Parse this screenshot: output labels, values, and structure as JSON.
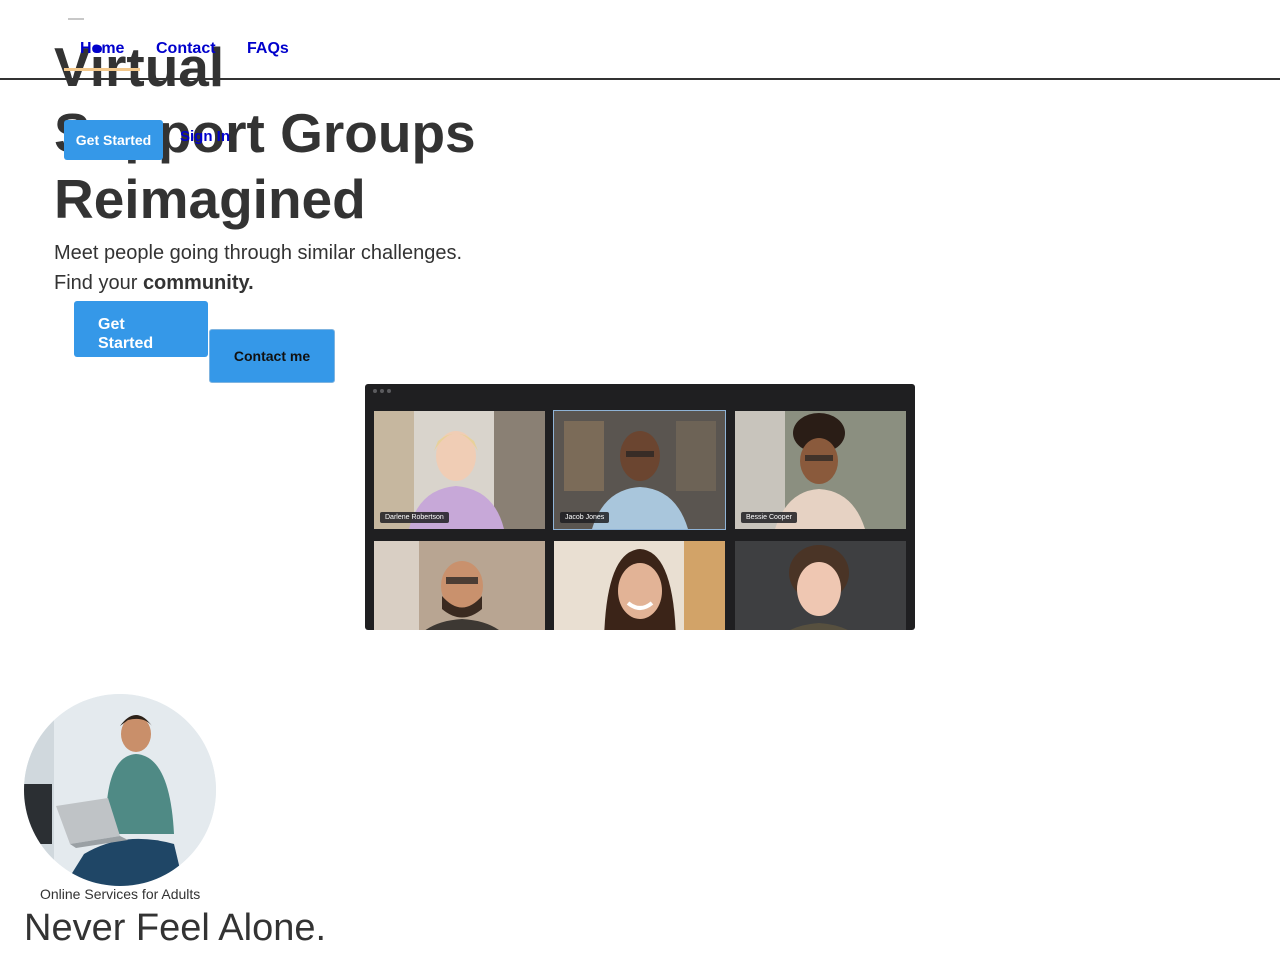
{
  "nav": {
    "links": [
      "Home",
      "Contact",
      "FAQs"
    ],
    "get_started": "Get Started",
    "sign_in": "Sign In",
    "active_color": "#0000cc",
    "underline_color": "#f3c88b"
  },
  "hero": {
    "title_lines": [
      "Virtual",
      "Support Groups",
      "Reimagined"
    ],
    "subtitle_line1": "Meet people going through similar challenges.",
    "subtitle_line2_prefix": "Find your ",
    "subtitle_line2_bold": "community.",
    "primary_button": "Get Started",
    "secondary_button": "Contact me",
    "button_color": "#3598e8"
  },
  "video_call": {
    "participants": [
      {
        "name": "Darlene Robertson"
      },
      {
        "name": "Jacob Jones"
      },
      {
        "name": "Bessie Cooper"
      },
      {
        "name": ""
      },
      {
        "name": ""
      },
      {
        "name": ""
      }
    ]
  },
  "services": {
    "label": "Online Services for Adults",
    "heading": "Never Feel Alone."
  }
}
